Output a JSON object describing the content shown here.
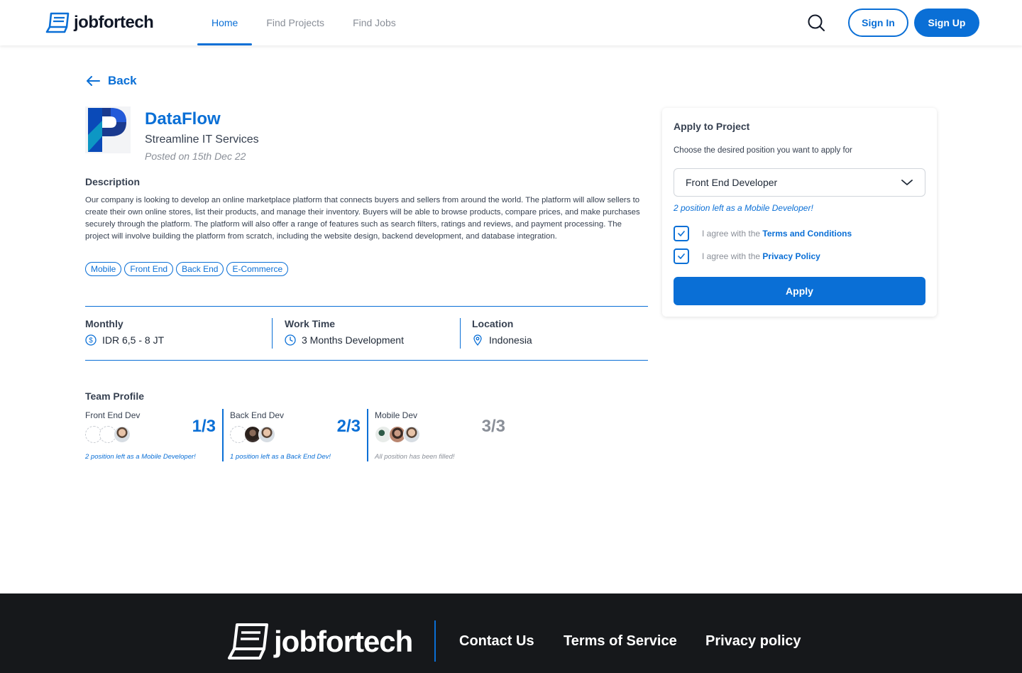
{
  "header": {
    "logo_text": "jobfortech",
    "nav": [
      {
        "label": "Home",
        "active": true
      },
      {
        "label": "Find Projects",
        "active": false
      },
      {
        "label": "Find Jobs",
        "active": false
      }
    ],
    "signin_label": "Sign In",
    "signup_label": "Sign Up",
    "accent_color": "#0a6fd6"
  },
  "back_label": "Back",
  "company": {
    "name": "DataFlow",
    "subtitle": "Streamline IT Services",
    "posted": "Posted on 15th Dec 22"
  },
  "description": {
    "title": "Description",
    "text": " Our company is looking to develop an online marketplace platform that connects buyers and sellers from around the world. The platform will allow sellers to create their own online stores, list their products, and manage their inventory. Buyers will be able to browse products, compare prices, and make purchases securely through the platform. The platform will also offer a range of features such as search filters, ratings and reviews, and payment processing. The project will involve building the platform from scratch, including the website design, backend development, and database integration.",
    "tags": [
      "Mobile",
      "Front End",
      "Back End",
      "E-Commerce"
    ]
  },
  "info": {
    "monthly": {
      "label": "Monthly",
      "value": "IDR 6,5 - 8 JT"
    },
    "work_time": {
      "label": "Work Time",
      "value": "3 Months Development"
    },
    "location": {
      "label": "Location",
      "value": "Indonesia"
    }
  },
  "team": {
    "title": "Team Profile",
    "roles": [
      {
        "role": "Front End Dev",
        "count": "1/3",
        "note": "2 position left as a Mobile Developer!",
        "filled": false
      },
      {
        "role": "Back End Dev",
        "count": "2/3",
        "note": "1 position left as a Back End Dev!",
        "filled": false
      },
      {
        "role": "Mobile Dev",
        "count": "3/3",
        "note": "All position has been filled!",
        "filled": true
      }
    ]
  },
  "apply": {
    "title": "Apply to Project",
    "subtitle": "Choose the desired position you want to apply for",
    "selected_position": "Front End Developer",
    "note": "2 position left as a Mobile Developer!",
    "agree_prefix": "I agree with the",
    "terms_link": "Terms and Conditions",
    "privacy_link": "Privacy Policy",
    "button_label": "Apply"
  },
  "footer": {
    "logo_text": "jobfortech",
    "links": [
      "Contact Us",
      "Terms of Service",
      "Privacy policy"
    ]
  }
}
